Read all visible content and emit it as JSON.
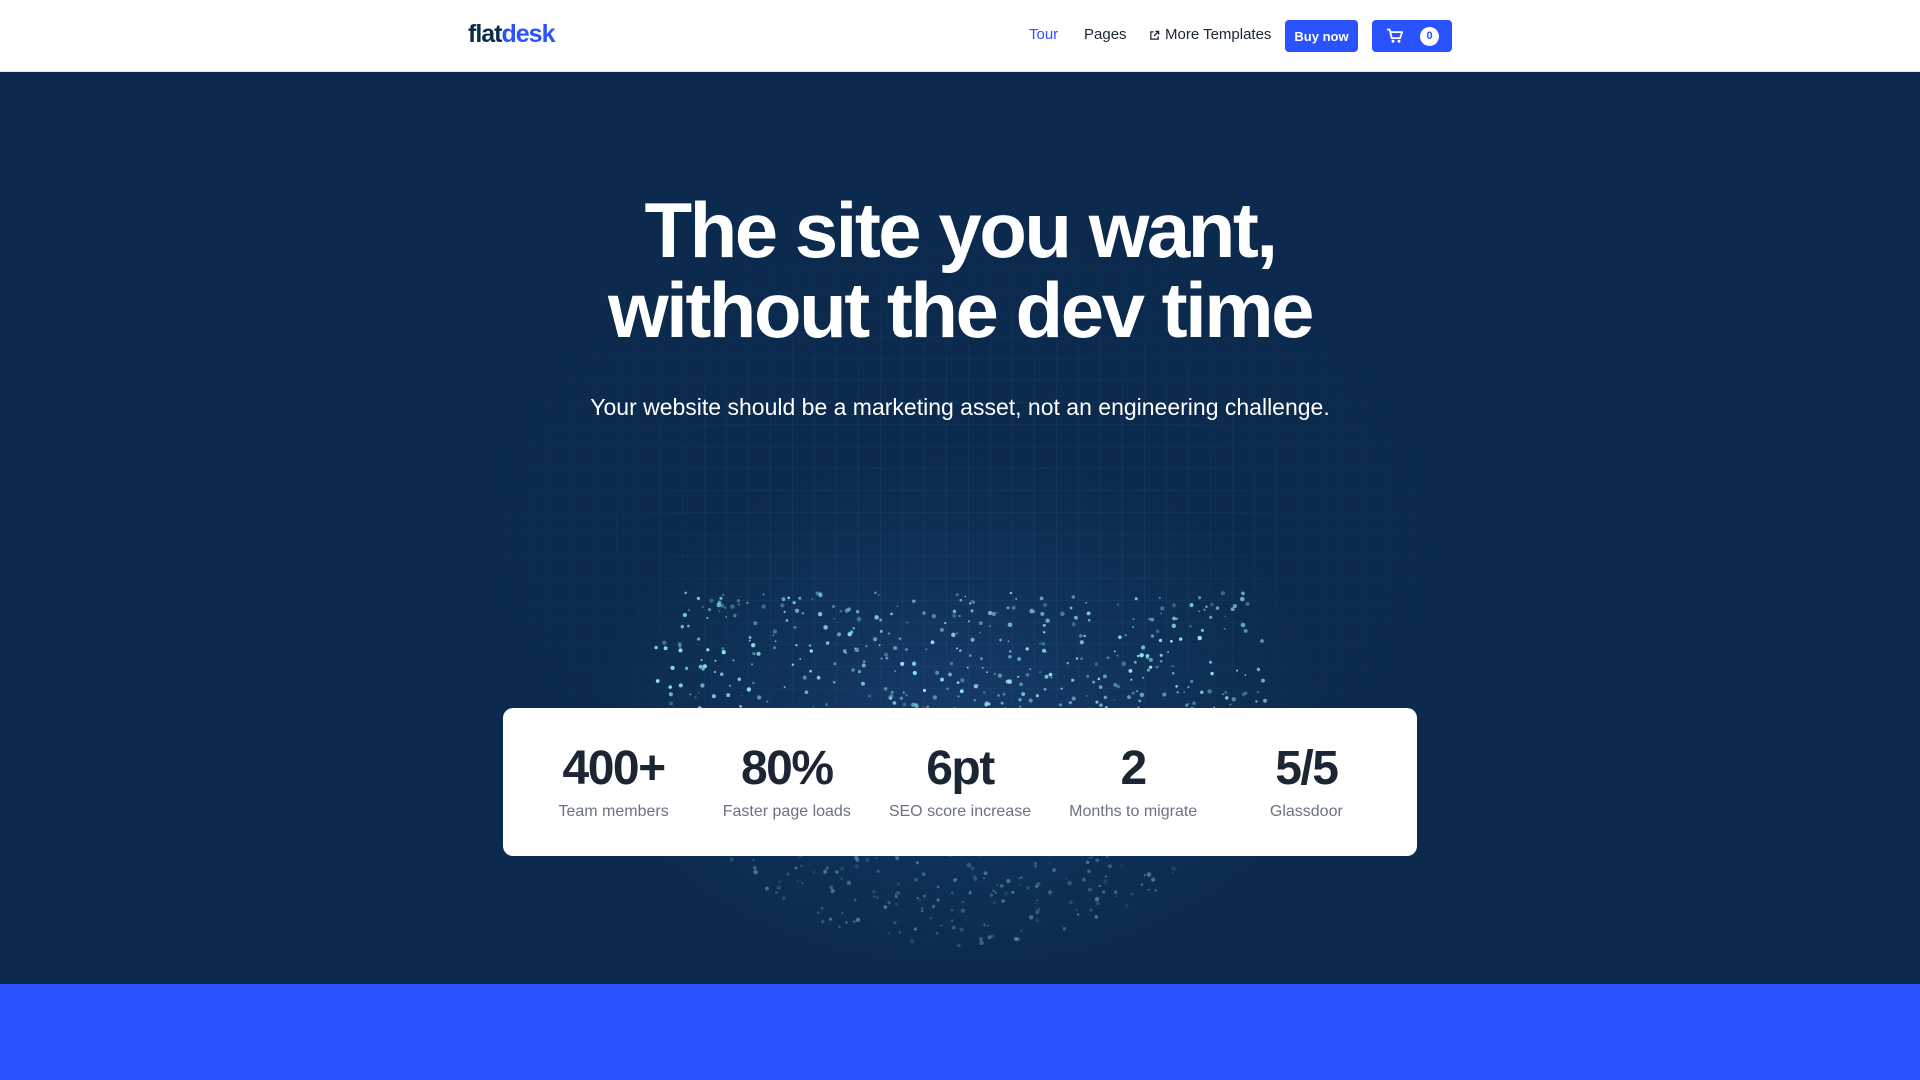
{
  "nav": {
    "logo_part1": "flat",
    "logo_part2": "desk",
    "tour": "Tour",
    "pages": "Pages",
    "more_templates": "More Templates",
    "buy_now": "Buy now",
    "cart_count": "0",
    "icons": {
      "external": "external-link-icon",
      "cart": "cart-icon"
    }
  },
  "hero": {
    "headline_line1": "The site you want,",
    "headline_line2": "without the dev time",
    "subheadline": "Your website should be a marketing asset, not an engineering challenge."
  },
  "stats": [
    {
      "value": "400+",
      "label": "Team members"
    },
    {
      "value": "80%",
      "label": "Faster page loads"
    },
    {
      "value": "6pt",
      "label": "SEO score increase"
    },
    {
      "value": "2",
      "label": "Months to migrate"
    },
    {
      "value": "5/5",
      "label": "Glassdoor"
    }
  ],
  "colors": {
    "primary": "#2a52ff",
    "hero_bg": "#0b2a4d",
    "particle": "#8fe3e8",
    "text_dark": "#1b2533",
    "text_muted": "#6b7380"
  }
}
